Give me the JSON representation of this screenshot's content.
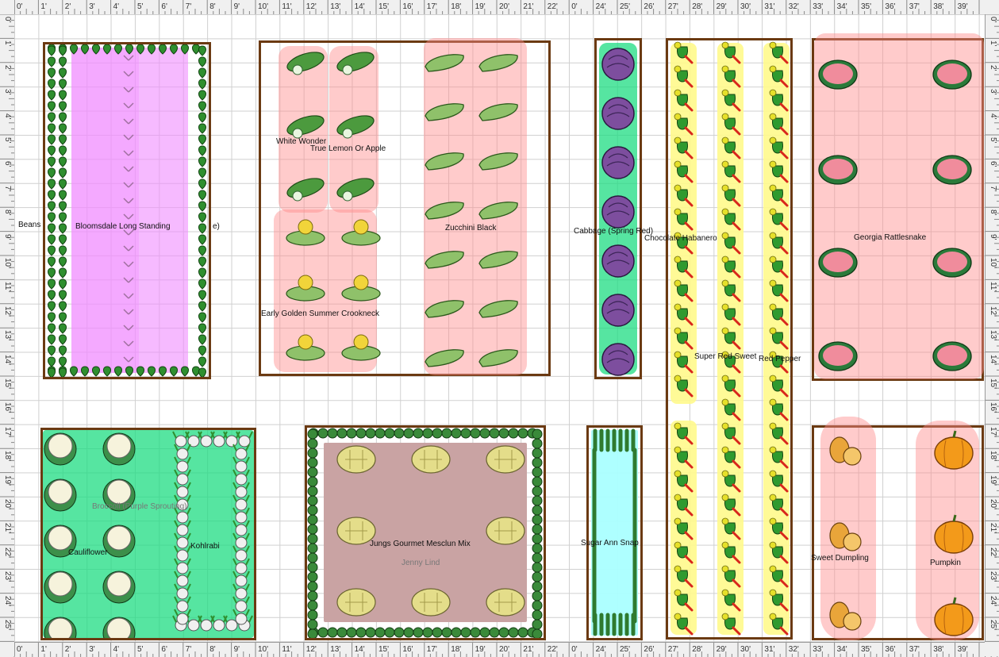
{
  "rulers": {
    "top": [
      "0'",
      "1'",
      "2'",
      "3'",
      "4'",
      "5'",
      "6'",
      "7'",
      "8'",
      "9'",
      "10'",
      "11'",
      "12'",
      "13'",
      "14'",
      "15'",
      "16'",
      "17'",
      "18'",
      "19'",
      "20'",
      "21'",
      "22'",
      "0'",
      "24'",
      "25'",
      "26'",
      "27'",
      "28'",
      "29'",
      "30'",
      "31'",
      "32'",
      "33'",
      "34'",
      "35'",
      "36'",
      "37'",
      "38'",
      "39'"
    ],
    "side": [
      "0'",
      "1'",
      "2'",
      "3'",
      "4'",
      "5'",
      "6'",
      "7'",
      "8'",
      "9'",
      "10'",
      "11'",
      "12'",
      "13'",
      "14'",
      "15'",
      "16'",
      "17'",
      "18'",
      "19'",
      "20'",
      "21'",
      "22'",
      "23'",
      "24'",
      "25'"
    ]
  },
  "labels": {
    "beans": "Beans",
    "bloomsdale": "Bloomsdale Long Standing",
    "bloomsdale_tail": "e)",
    "white_wonder": "White Wonder",
    "true_lemon": "True Lemon Or Apple",
    "zucchini": "Zucchini Black",
    "crookneck": "Early Golden Summer Crookneck",
    "cabbage": "Cabbage (Spring Red)",
    "habanero": "Chocolate Habanero",
    "sweet_pepper": "Super Red Sweet",
    "red_pepper": "Red Pepper",
    "watermelon": "Georgia Rattlesnake",
    "broccoli": "Broccoli (Purple Sprouting)",
    "cauliflower": "Cauliflower",
    "kohlrabi": "Kohlrabi",
    "mesclun": "Jungs Gourmet Mesclun Mix",
    "jenny": "Jenny Lind",
    "peas": "Sugar Ann Snap",
    "dumpling": "Sweet Dumpling",
    "pumpkin": "Pumpkin"
  },
  "colors": {
    "bed_border": "#6b3a12",
    "grid": "#d0d0d0"
  }
}
